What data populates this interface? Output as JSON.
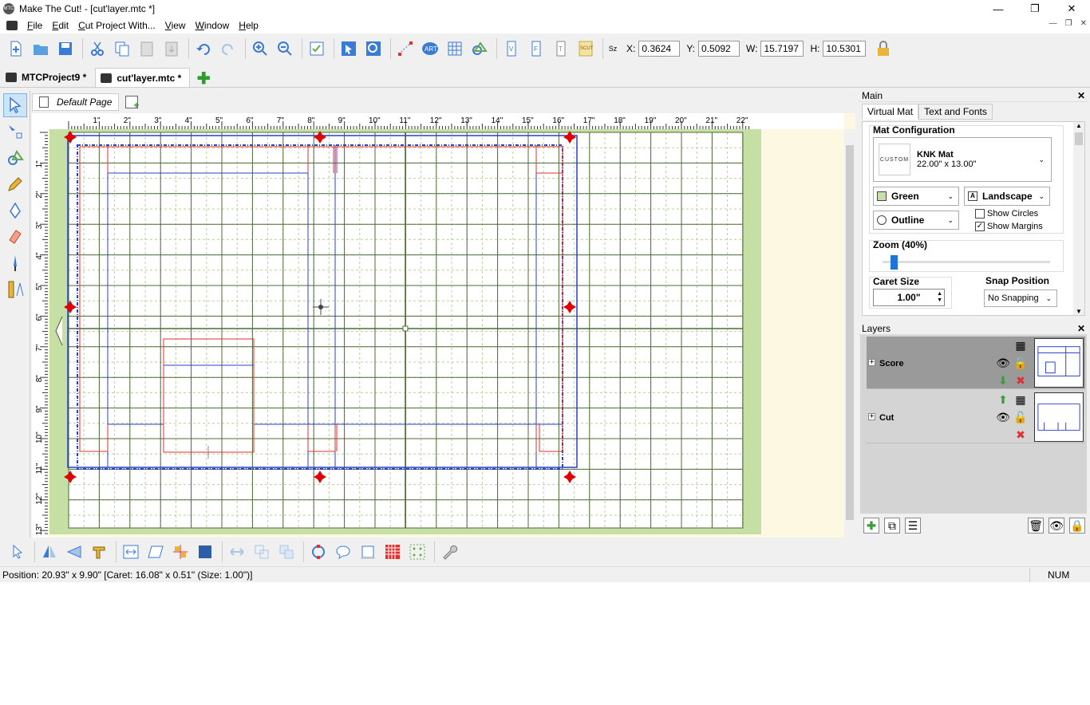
{
  "window": {
    "title": "Make The Cut! - [cut'layer.mtc *]",
    "app_icon": "MTC",
    "controls": {
      "minimize": "—",
      "maximize": "❐",
      "close": "✕"
    }
  },
  "menu": [
    "File",
    "Edit",
    "Cut Project With...",
    "View",
    "Window",
    "Help"
  ],
  "toolbar": {
    "x_label": "X:",
    "x_value": "0.3624",
    "y_label": "Y:",
    "y_value": "0.5092",
    "w_label": "W:",
    "w_value": "15.7197",
    "h_label": "H:",
    "h_value": "10.5301",
    "sz_label": "Sz"
  },
  "tabs": [
    {
      "label": "MTCProject9 *"
    },
    {
      "label": "cut'layer.mtc *"
    }
  ],
  "page_tab": {
    "label": "Default Page"
  },
  "ruler": {
    "top": [
      "1\"",
      "2\"",
      "3\"",
      "4\"",
      "5\"",
      "6\"",
      "7\"",
      "8\"",
      "9\"",
      "10\"",
      "11\"",
      "12\"",
      "13\"",
      "14\"",
      "15\"",
      "16\"",
      "17\"",
      "18\"",
      "19\"",
      "20\"",
      "21\"",
      "22\""
    ],
    "left": [
      "1\"",
      "2\"",
      "3\"",
      "4\"",
      "5\"",
      "6\"",
      "7\"",
      "8\"",
      "9\"",
      "10\"",
      "11\"",
      "12\"",
      "13\""
    ]
  },
  "status": {
    "text": "Position: 20.93\" x 9.90\" [Caret: 16.08\" x 0.51\" (Size: 1.00\")]",
    "num": "NUM"
  },
  "main_panel": {
    "title": "Main",
    "tabs": [
      "Virtual Mat",
      "Text and Fonts"
    ],
    "mat_config_label": "Mat Configuration",
    "mat_icon_text": "CUSTOM",
    "mat_name": "KNK Mat",
    "mat_size": "22.00\" x 13.00\"",
    "color": "Green",
    "orientation": "Landscape",
    "style": "Outline",
    "show_circles": "Show Circles",
    "show_circles_checked": false,
    "show_margins": "Show Margins",
    "show_margins_checked": true,
    "zoom_label": "Zoom (40%)",
    "zoom_level": 0.05,
    "caret_label": "Caret Size",
    "caret_value": "1.00\"",
    "snap_label": "Snap Position",
    "snap_value": "No Snapping"
  },
  "layers_panel": {
    "title": "Layers",
    "layers": [
      {
        "name": "Score"
      },
      {
        "name": "Cut"
      }
    ]
  },
  "colors": {
    "mat_green": "#c6dfa4",
    "grid": "#4d6b3a",
    "cut": "#e03030",
    "score": "#2a3fc8",
    "handles": "#e00000",
    "background": "#fdf8e1"
  }
}
